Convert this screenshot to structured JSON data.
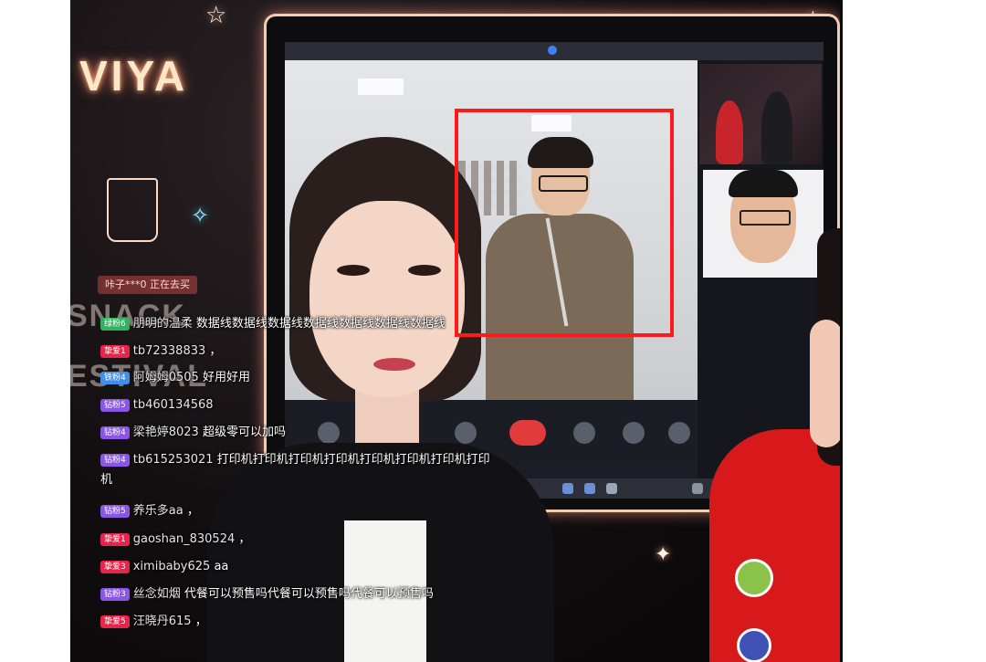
{
  "stage": {
    "sign_text": "VIYA",
    "backdrop_text_1": "SNACK",
    "backdrop_text_2": "ESTIVAL"
  },
  "highlight_color": "#ff1a1a",
  "enter_notice": "咔子***0 正在去买",
  "comments": [
    {
      "level": "绿粉6",
      "level_color": "green",
      "user": "朋明的温柔",
      "text": "数据线数据线数据线数据线数据线数据线数据线"
    },
    {
      "level": "挚爱1",
      "level_color": "red",
      "user": "tb72338833",
      "text": "，"
    },
    {
      "level": "铁粉4",
      "level_color": "blue",
      "user": "阿姆姆0505",
      "text": "好用好用"
    },
    {
      "level": "钻粉5",
      "level_color": "purple",
      "user": "tb460134568",
      "text": ""
    },
    {
      "level": "钻粉4",
      "level_color": "purple",
      "user": "梁艳婷8023",
      "text": "超级零可以加吗"
    },
    {
      "level": "钻粉4",
      "level_color": "purple",
      "user": "tb615253021",
      "text": "打印机打印机打印机打印机打印机打印机打印机打印"
    },
    {
      "level": "",
      "level_color": "",
      "user": "",
      "text": "机"
    },
    {
      "level": "钻粉5",
      "level_color": "purple",
      "user": "养乐多aa",
      "text": "，"
    },
    {
      "level": "挚爱1",
      "level_color": "red",
      "user": "gaoshan_830524",
      "text": "，"
    },
    {
      "level": "挚爱3",
      "level_color": "red",
      "user": "ximibaby625",
      "text": "aa"
    },
    {
      "level": "钻粉3",
      "level_color": "purple",
      "user": "丝念如烟",
      "text": "代餐可以预售吗代餐可以预售吗代餐可以预售吗"
    },
    {
      "level": "挚爱5",
      "level_color": "red",
      "user": "汪晓丹615",
      "text": "，"
    }
  ]
}
